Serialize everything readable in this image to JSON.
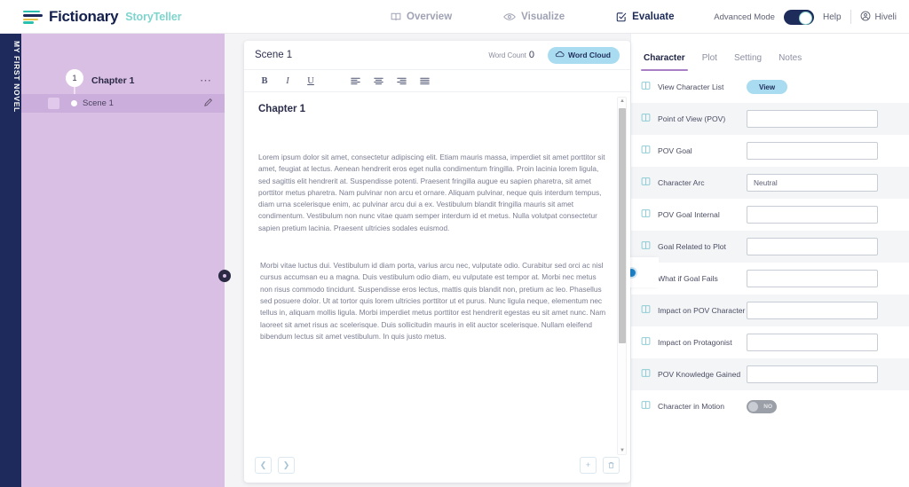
{
  "header": {
    "brand": "Fictionary",
    "brand_sub": "StoryTeller",
    "nav": [
      {
        "label": "Overview",
        "icon": "book-open-icon",
        "active": false
      },
      {
        "label": "Visualize",
        "icon": "eye-icon",
        "active": false
      },
      {
        "label": "Evaluate",
        "icon": "checkbox-badge-icon",
        "active": true
      }
    ],
    "advanced_mode_label": "Advanced Mode",
    "advanced_mode_on": true,
    "help_label": "Help",
    "user_name": "Hiveli"
  },
  "project": {
    "spine_title": "MY FIRST NOVEL"
  },
  "sidebar": {
    "chapter": {
      "number": "1",
      "title": "Chapter 1",
      "menu_icon": "ellipsis-icon"
    },
    "scene": {
      "label": "Scene 1",
      "edit_icon": "pencil-icon",
      "selected": true
    }
  },
  "editor": {
    "scene_title": "Scene 1",
    "word_count_label": "Word Count",
    "word_count_value": "0",
    "word_cloud_label": "Word Cloud",
    "toolbar": [
      {
        "name": "bold-button",
        "glyph": "B"
      },
      {
        "name": "italic-button",
        "glyph": "I"
      },
      {
        "name": "underline-button",
        "glyph": "U"
      }
    ],
    "doc_heading": "Chapter 1",
    "paragraphs": [
      "Lorem ipsum dolor sit amet, consectetur adipiscing elit. Etiam mauris massa, imperdiet sit amet porttitor sit amet, feugiat at lectus. Aenean hendrerit eros eget nulla condimentum fringilla. Proin lacinia lorem ligula, sed sagittis elit hendrerit at. Suspendisse potenti. Praesent fringilla augue eu sapien pharetra, sit amet porttitor metus pharetra. Nam pulvinar non arcu et ornare. Aliquam pulvinar, neque quis interdum tempus, diam urna scelerisque enim, ac pulvinar arcu dui a ex. Vestibulum blandit fringilla mauris sit amet condimentum. Vestibulum non nunc vitae quam semper interdum id et metus. Nulla volutpat consectetur sapien pretium lacinia. Praesent ultricies sodales euismod.",
      "Morbi vitae luctus dui. Vestibulum id diam porta, varius arcu nec, vulputate odio. Curabitur sed orci ac nisl cursus accumsan eu a magna. Duis vestibulum odio diam, eu vulputate est tempor at. Morbi nec metus non risus commodo tincidunt. Suspendisse eros lectus, mattis quis blandit non, pretium ac leo. Phasellus sed posuere dolor. Ut at tortor quis lorem ultricies porttitor ut et purus. Nunc ligula neque, elementum nec tellus in, aliquam mollis ligula. Morbi imperdiet metus porttitor est hendrerit egestas eu sit amet nunc. Nam laoreet sit amet risus ac scelerisque. Duis sollicitudin mauris in elit auctor scelerisque. Nullam eleifend bibendum lectus sit amet vestibulum. In quis justo metus."
    ]
  },
  "right_panel": {
    "tabs": [
      {
        "label": "Character",
        "active": true
      },
      {
        "label": "Plot",
        "active": false
      },
      {
        "label": "Setting",
        "active": false
      },
      {
        "label": "Notes",
        "active": false
      }
    ],
    "rows": [
      {
        "label": "View Character List",
        "control": "button",
        "value": "View"
      },
      {
        "label": "Point of View (POV)",
        "control": "input",
        "value": "",
        "placeholder": ""
      },
      {
        "label": "POV Goal",
        "control": "input",
        "value": "",
        "placeholder": ""
      },
      {
        "label": "Character Arc",
        "control": "input",
        "value": "Neutral",
        "placeholder": ""
      },
      {
        "label": "POV Goal Internal",
        "control": "input",
        "value": "",
        "placeholder": ""
      },
      {
        "label": "Goal Related to Plot",
        "control": "input",
        "value": "",
        "placeholder": ""
      },
      {
        "label": "What if Goal Fails",
        "control": "input",
        "value": "",
        "placeholder": ""
      },
      {
        "label": "Impact on POV Character",
        "control": "input",
        "value": "",
        "placeholder": ""
      },
      {
        "label": "Impact on Protagonist",
        "control": "input",
        "value": "",
        "placeholder": ""
      },
      {
        "label": "POV Knowledge Gained",
        "control": "input",
        "value": "",
        "placeholder": ""
      },
      {
        "label": "Character in Motion",
        "control": "toggle",
        "value": "NO"
      }
    ]
  },
  "colors": {
    "navy": "#1d2a5b",
    "purple_sidebar": "#d9bfe4",
    "purple_selected": "#cbaedb",
    "accent_teal": "#2bbfae",
    "pill_blue": "#a9dcf0",
    "tab_underline": "#a97fc5"
  }
}
